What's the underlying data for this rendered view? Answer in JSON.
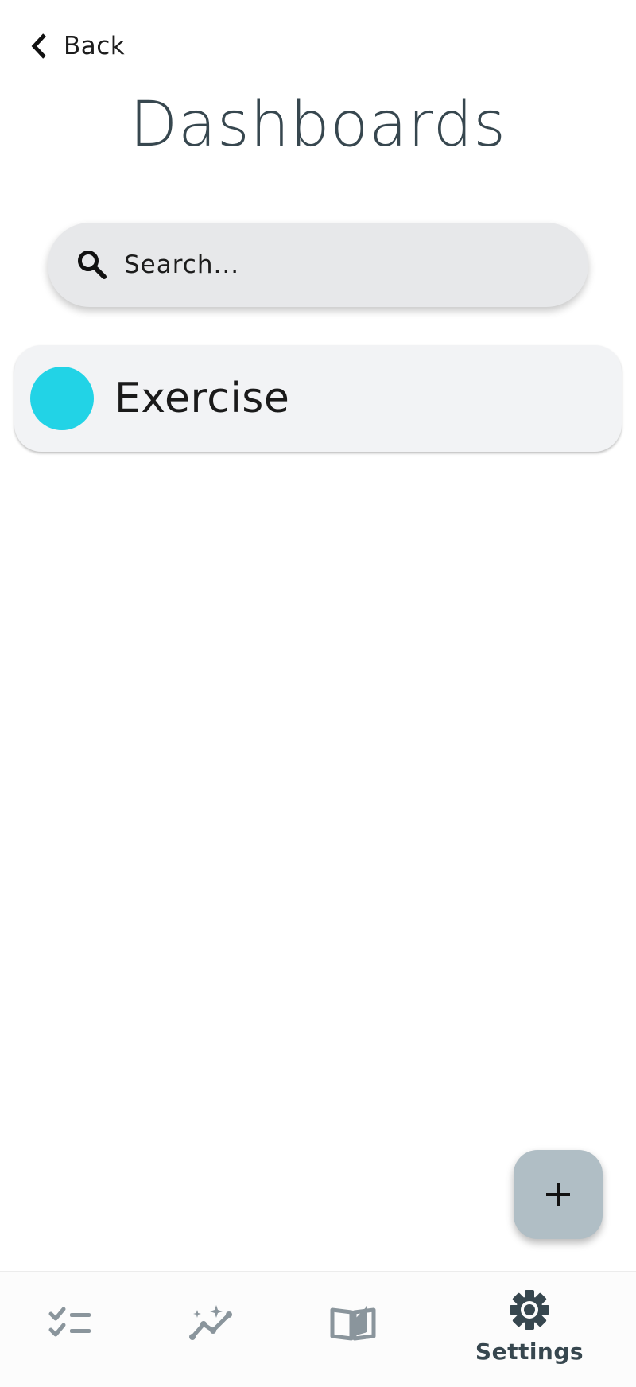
{
  "header": {
    "back_label": "Back",
    "title": "Dashboards"
  },
  "search": {
    "placeholder": "Search...",
    "value": ""
  },
  "dashboards": [
    {
      "label": "Exercise",
      "color": "#22d3e6"
    }
  ],
  "fab": {
    "icon": "plus-icon"
  },
  "bottom_nav": {
    "active_color": "#37474f",
    "inactive_color": "#8a959c",
    "items": [
      {
        "icon": "tasks-checklist-icon",
        "label": "",
        "active": false
      },
      {
        "icon": "insights-chart-icon",
        "label": "",
        "active": false
      },
      {
        "icon": "journal-book-icon",
        "label": "",
        "active": false
      },
      {
        "icon": "gear-icon",
        "label": "Settings",
        "active": true
      }
    ]
  }
}
